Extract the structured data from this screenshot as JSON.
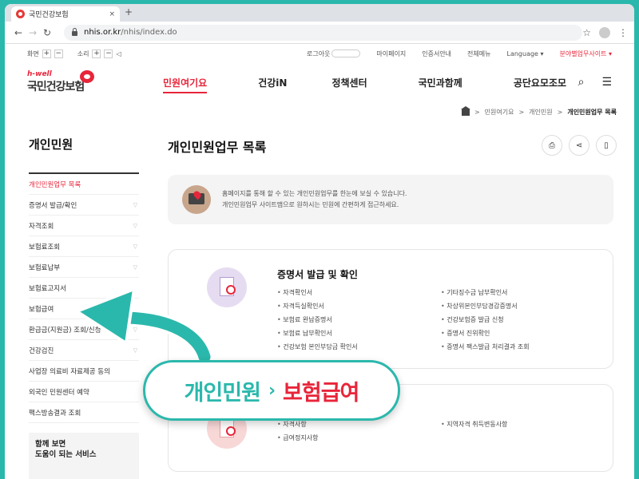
{
  "colors": {
    "accent_red": "#e8253a",
    "teal": "#2bb8ac"
  },
  "browser": {
    "tab_title": "국민건강보험",
    "tab_close": "×",
    "new_tab": "+",
    "url_host": "nhis.or.kr",
    "url_path": "/nhis/index.do"
  },
  "util": {
    "screen_label": "화면",
    "sound_label": "소리",
    "plus": "+",
    "minus": "−",
    "login": "로그아웃",
    "mypage": "마이페이지",
    "cert": "인증서안내",
    "sitemap": "전체메뉴",
    "language": "Language",
    "affiliated": "분야별업무사이트"
  },
  "logo": {
    "sub": "h-well",
    "main": "국민건강보험"
  },
  "gnb": {
    "items": [
      {
        "label": "민원여기요"
      },
      {
        "label": "건강iN"
      },
      {
        "label": "정책센터"
      },
      {
        "label": "국민과함께"
      },
      {
        "label": "공단요모조모"
      }
    ]
  },
  "breadcrumb": {
    "items": [
      "민원여기요",
      "개인민원",
      "개인민원업무 목록"
    ],
    "sep": ">"
  },
  "lnb": {
    "title": "개인민원",
    "items": [
      {
        "label": "개인민원업무 목록"
      },
      {
        "label": "증명서 발급/확인"
      },
      {
        "label": "자격조회"
      },
      {
        "label": "보험료조회"
      },
      {
        "label": "보험료납부"
      },
      {
        "label": "보험료고지서"
      },
      {
        "label": "보험급여"
      },
      {
        "label": "환급금(지원금) 조회/신청"
      },
      {
        "label": "건강검진"
      },
      {
        "label": "사업장 의료비 자료제공 동의"
      },
      {
        "label": "외국인 민원센터 예약"
      },
      {
        "label": "팩스방송결과 조회"
      }
    ],
    "box_line1": "함께 보면",
    "box_line2": "도움이 되는 서비스"
  },
  "main": {
    "title": "개인민원업무 목록",
    "notice_line1": "홈페이지를 통해 할 수 있는 개인민원업무를 한눈에 보실 수 있습니다.",
    "notice_line2": "개인민원업무 사이트맵으로 원하시는 민원에 간편하게 접근하세요.",
    "cards": [
      {
        "title": "증명서 발급 및 확인",
        "left": [
          "자격확인서",
          "자격득실확인서",
          "보험료 완납증명서",
          "보험료 납부확인서",
          "건강보험 본인부담금 확인서"
        ],
        "right": [
          "기타징수금 납부확인서",
          "차상위본인부담경감증명서",
          "건강보험증 발급 신청",
          "증명서 진위확인",
          "증명서 팩스발급 처리결과 조회"
        ]
      },
      {
        "title": "",
        "left": [
          "자격사항",
          "급여정지사항"
        ],
        "right": [
          "지역자격 취득변동사항"
        ]
      }
    ]
  },
  "callout": {
    "part_a": "개인민원",
    "sep": "›",
    "part_b": "보험급여"
  }
}
